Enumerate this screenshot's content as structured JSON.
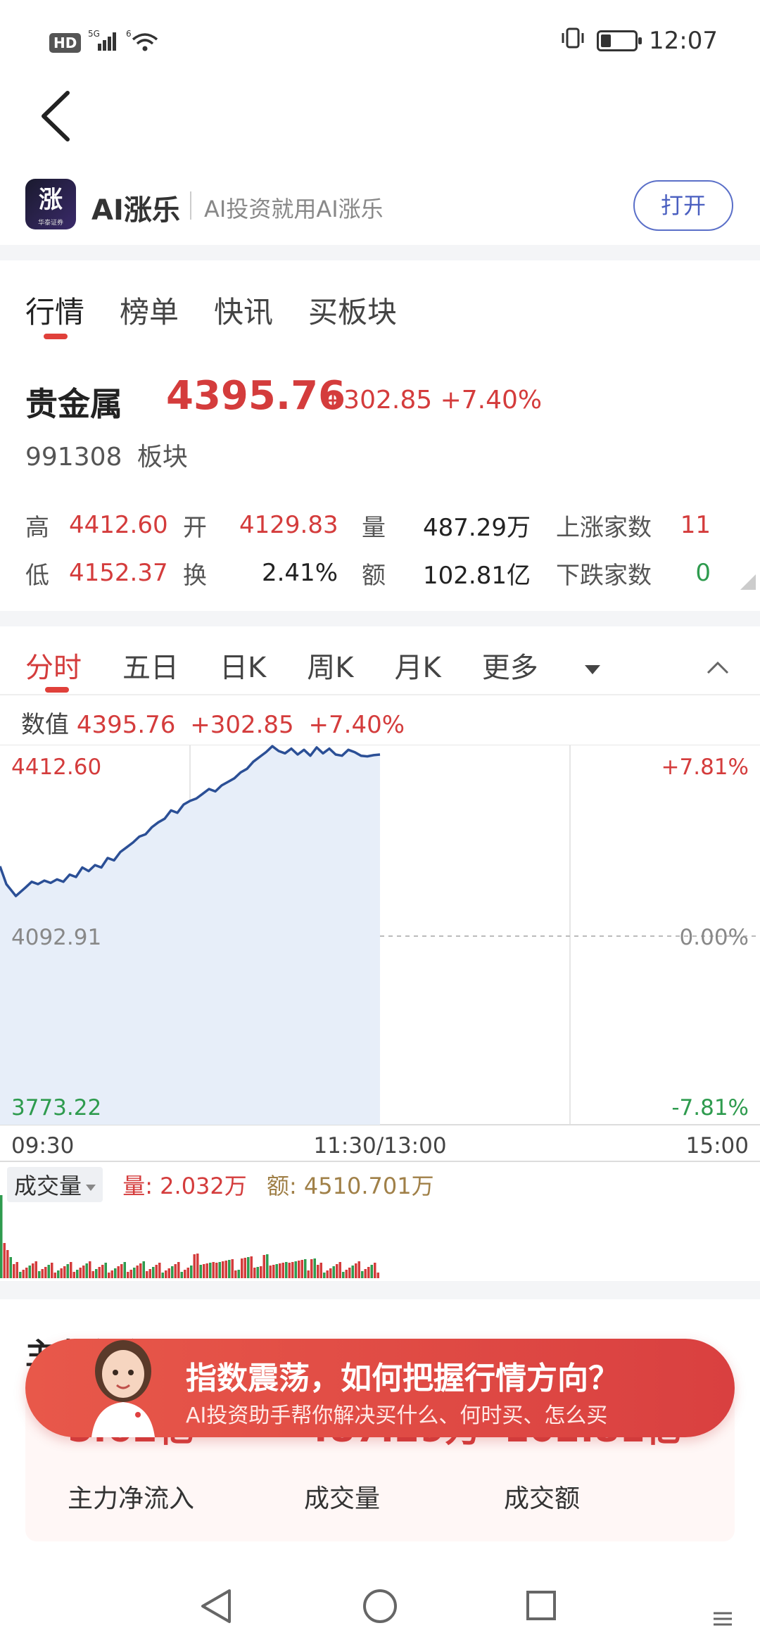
{
  "status_bar": {
    "hd": "HD",
    "signal": "5G",
    "wifi": "6",
    "time": "12:07"
  },
  "app_banner": {
    "logo_text": "涨",
    "logo_sub": "华泰证券",
    "name": "AI涨乐",
    "slogan": "AI投资就用AI涨乐",
    "open_label": "打开"
  },
  "tabs": [
    "行情",
    "榜单",
    "快讯",
    "买板块"
  ],
  "quote": {
    "name": "贵金属",
    "price": "4395.76",
    "change": "+302.85",
    "change_pct": "+7.40%",
    "code": "991308",
    "type": "板块"
  },
  "stats": {
    "high_label": "高",
    "high": "4412.60",
    "low_label": "低",
    "low": "4152.37",
    "open_label": "开",
    "open": "4129.83",
    "turnover_label": "换",
    "turnover": "2.41%",
    "volume_label": "量",
    "volume": "487.29万",
    "amount_label": "额",
    "amount": "102.81亿",
    "up_label": "上涨家数",
    "up_count": "11",
    "down_label": "下跌家数",
    "down_count": "0"
  },
  "chart_tabs": [
    "分时",
    "五日",
    "日K",
    "周K",
    "月K",
    "更多"
  ],
  "value_row": {
    "label": "数值",
    "price": "4395.76",
    "change": "+302.85",
    "pct": "+7.40%"
  },
  "chart_data": {
    "type": "line",
    "y_top": "4412.60",
    "y_mid": "4092.91",
    "y_bottom": "3773.22",
    "pct_top": "+7.81%",
    "pct_mid": "0.00%",
    "pct_bottom": "-7.81%",
    "x_labels": [
      "09:30",
      "11:30/13:00",
      "15:00"
    ],
    "ylim": [
      3773.22,
      4412.6
    ],
    "x_total": 240,
    "series": [
      {
        "x": [
          0,
          2,
          5,
          8,
          10,
          12,
          14,
          16,
          18,
          20,
          22,
          24,
          26,
          28,
          30,
          32,
          34,
          36,
          38,
          40,
          42,
          44,
          46,
          48,
          50,
          52,
          54,
          56,
          58,
          60,
          62,
          64,
          66,
          68,
          70,
          72,
          74,
          76,
          78,
          80,
          82,
          84,
          86,
          88,
          90,
          92,
          94,
          96,
          98,
          100,
          102,
          104,
          106,
          108,
          110,
          112,
          114,
          116,
          118,
          120
        ],
        "values": [
          4208,
          4178,
          4158,
          4172,
          4182,
          4178,
          4184,
          4180,
          4186,
          4182,
          4194,
          4190,
          4206,
          4200,
          4210,
          4206,
          4222,
          4218,
          4232,
          4240,
          4248,
          4258,
          4262,
          4274,
          4282,
          4288,
          4302,
          4298,
          4312,
          4318,
          4322,
          4330,
          4338,
          4334,
          4344,
          4350,
          4356,
          4366,
          4372,
          4384,
          4392,
          4400,
          4410,
          4402,
          4398,
          4406,
          4396,
          4404,
          4394,
          4408,
          4398,
          4406,
          4396,
          4394,
          4404,
          4400,
          4394,
          4393,
          4395,
          4396
        ]
      }
    ]
  },
  "volume": {
    "tab_label": "成交量",
    "vol_label": "量:",
    "vol_value": "2.032万",
    "amt_label": "额:",
    "amt_value": "4510.701万"
  },
  "flow": {
    "section_title": "主力净流",
    "values": [
      "5.62亿",
      "487.29万",
      "102.81亿"
    ],
    "labels": [
      "主力净流入",
      "成交量",
      "成交额"
    ]
  },
  "promo": {
    "title": "指数震荡，如何把握行情方向？",
    "subtitle": "AI投资助手帮你解决买什么、何时买、怎么买"
  },
  "colors": {
    "up": "#d43c3c",
    "down": "#2e9b4e",
    "line": "#2b4f96",
    "area": "#e7eef9"
  }
}
